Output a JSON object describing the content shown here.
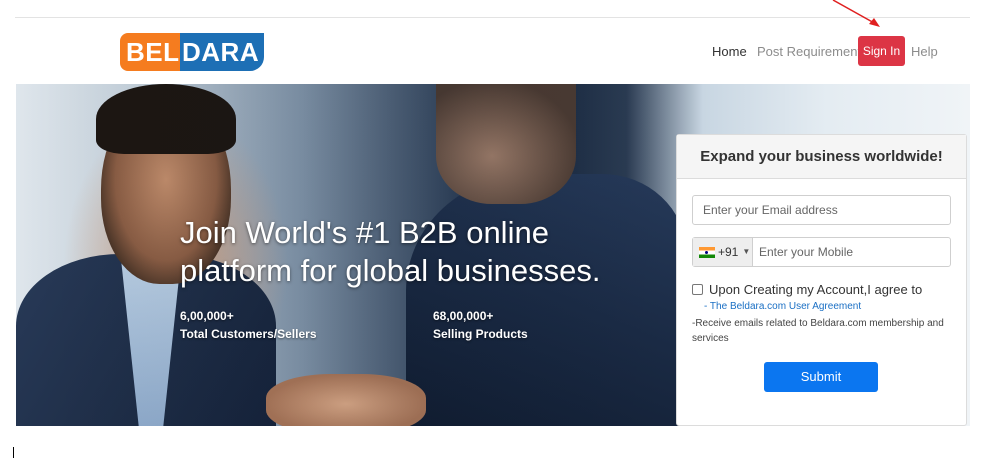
{
  "brand": {
    "part1": "BEL",
    "part2": "DARA"
  },
  "nav": {
    "home": "Home",
    "post_requirement": "Post Requirement",
    "sign_in": "Sign In",
    "help": "Help"
  },
  "hero": {
    "headline": "Join World's #1 B2B online platform for global businesses.",
    "stats": [
      {
        "value": "6,00,000+",
        "label": "Total Customers/Sellers"
      },
      {
        "value": "68,00,000+",
        "label": "Selling Products"
      }
    ]
  },
  "form": {
    "title": "Expand your business worldwide!",
    "email_placeholder": "Enter your Email address",
    "country_code": "+91",
    "mobile_placeholder": "Enter your Mobile",
    "agree_text": "Upon Creating my Account,I agree to",
    "agreement_link": "- The Beldara.com User Agreement",
    "emails_note": "-Receive emails related to Beldara.com membership and services",
    "submit_label": "Submit"
  },
  "colors": {
    "sign_in_bg": "#dc3545",
    "submit_bg": "#0b76f0",
    "logo_orange": "#f57c1f",
    "logo_blue": "#1d6fb5",
    "annotation_arrow": "#e02020"
  }
}
